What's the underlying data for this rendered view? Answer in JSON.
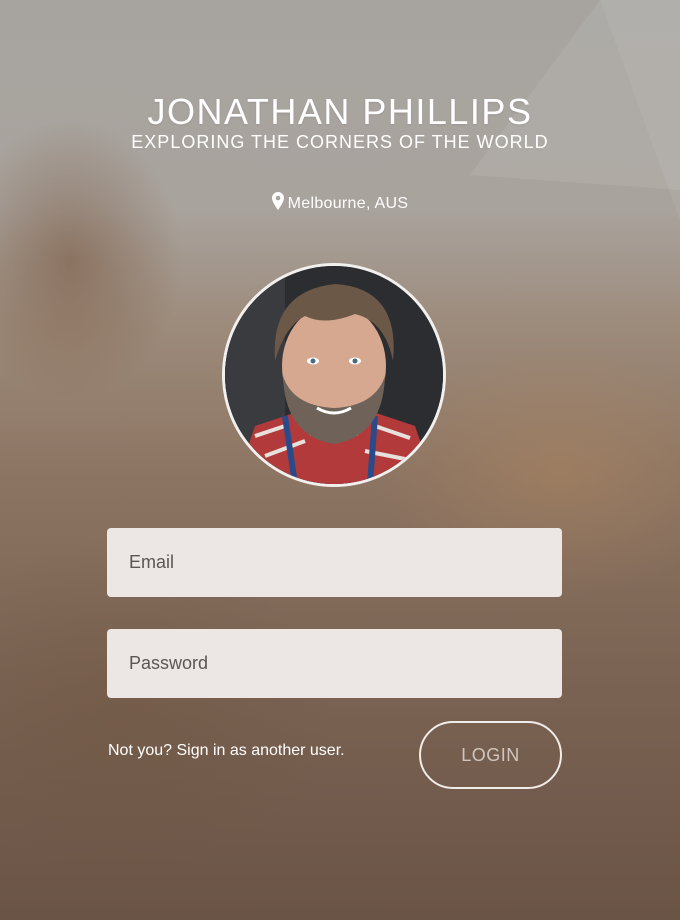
{
  "profile": {
    "name": "JONATHAN PHILLIPS",
    "tagline": "EXPLORING THE CORNERS OF THE WORLD",
    "location": "Melbourne, AUS",
    "location_icon": "map-pin-icon"
  },
  "form": {
    "email_placeholder": "Email",
    "password_placeholder": "Password",
    "switch_user_link": "Not you? Sign in as another user.",
    "login_label": "LOGIN"
  },
  "colors": {
    "field_bg": "#ece7e4",
    "text": "#ffffff",
    "login_text": "#cfc6bf"
  }
}
